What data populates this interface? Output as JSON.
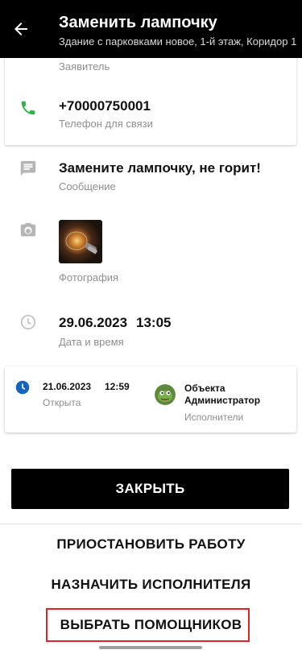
{
  "header": {
    "title": "Заменить лампочку",
    "subtitle": "Здание с парковками новое, 1-й этаж, Коридор 1"
  },
  "requester": {
    "value": "",
    "label": "Заявитель"
  },
  "phone": {
    "value": "+70000750001",
    "label": "Телефон для связи"
  },
  "message": {
    "value": "Замените лампочку, не горит!",
    "label": "Сообщение"
  },
  "photo": {
    "label": "Фотография"
  },
  "datetime": {
    "date": "29.06.2023",
    "time": "13:05",
    "label": "Дата и время"
  },
  "history": {
    "date": "21.06.2023",
    "time": "12:59",
    "status": "Открыта",
    "assignee_line1": "Объекта",
    "assignee_line2": "Администратор",
    "assignee_label": "Исполнители"
  },
  "actions": {
    "close": "ЗАКРЫТЬ",
    "pause": "ПРИОСТАНОВИТЬ РАБОТУ",
    "assign": "НАЗНАЧИТЬ ИСПОЛНИТЕЛЯ",
    "helpers": "ВЫБРАТЬ ПОМОЩНИКОВ"
  },
  "colors": {
    "header_bg": "#000000",
    "phone_icon": "#2eb24a",
    "clock_icon": "#1565c0",
    "highlight": "#e02424"
  }
}
